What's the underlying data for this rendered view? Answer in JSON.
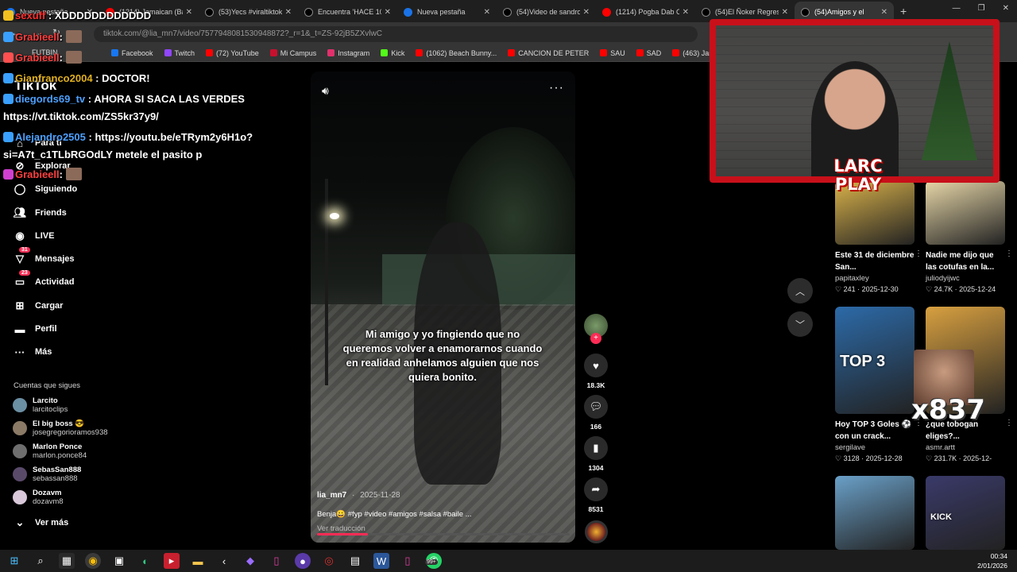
{
  "browser": {
    "tabs": [
      {
        "title": "Nueva pestaña",
        "color": "#1a73e8",
        "active": false
      },
      {
        "title": "(1214) Jamaican (Bam",
        "color": "#ff0000",
        "active": false
      },
      {
        "title": "(53)Yecs #viraltiktok #",
        "color": "#000000",
        "active": false
      },
      {
        "title": "Encuentra 'HACE 10 /",
        "color": "#000000",
        "active": false
      },
      {
        "title": "Nueva pestaña",
        "color": "#1a73e8",
        "active": false
      },
      {
        "title": "(54)Video de sandro",
        "color": "#000000",
        "active": false
      },
      {
        "title": "(1214) Pogba Dab Ce",
        "color": "#ff0000",
        "active": false
      },
      {
        "title": "(54)El Ñoker Regresa",
        "color": "#000000",
        "active": false
      },
      {
        "title": "(54)Amigos y el",
        "color": "#000000",
        "active": true
      }
    ],
    "url": "tiktok.com/@lia_mn7/video/7577948081530948872?_r=1&_t=ZS-92jB5ZXvlwC",
    "bookmarks": [
      {
        "label": "Facebook",
        "color": "#1877f2"
      },
      {
        "label": "Twitch",
        "color": "#9146ff"
      },
      {
        "label": "(72) YouTube",
        "color": "#ff0000"
      },
      {
        "label": "Mi Campus",
        "color": "#c8102e"
      },
      {
        "label": "Instagram",
        "color": "#e1306c"
      },
      {
        "label": "Kick",
        "color": "#53fc18"
      },
      {
        "label": "(1062) Beach Bunny...",
        "color": "#ff0000"
      },
      {
        "label": "CANCION DE PETER",
        "color": "#ff0000"
      },
      {
        "label": "SAU",
        "color": "#ff0000"
      },
      {
        "label": "SAD",
        "color": "#ff0000"
      },
      {
        "label": "(463) James Arthur -...",
        "color": "#ff0000"
      },
      {
        "label": "DR",
        "color": "#ff0000"
      }
    ],
    "bookmark_prefix": "FUTBIN"
  },
  "tiktok": {
    "logo": "TikTok",
    "nav": [
      {
        "label": "Para ti",
        "icon": "home-icon",
        "badge": ""
      },
      {
        "label": "Explorar",
        "icon": "compass-icon",
        "badge": ""
      },
      {
        "label": "Siguiendo",
        "icon": "following-icon",
        "badge": ""
      },
      {
        "label": "Friends",
        "icon": "friends-icon",
        "badge": ""
      },
      {
        "label": "LIVE",
        "icon": "live-icon",
        "badge": ""
      },
      {
        "label": "Mensajes",
        "icon": "messages-icon",
        "badge": "31"
      },
      {
        "label": "Actividad",
        "icon": "activity-icon",
        "badge": "23"
      },
      {
        "label": "Cargar",
        "icon": "upload-icon",
        "badge": ""
      },
      {
        "label": "Perfil",
        "icon": "profile-icon",
        "badge": ""
      },
      {
        "label": "Más",
        "icon": "more-icon",
        "badge": ""
      }
    ],
    "following_title": "Cuentas que sigues",
    "following": [
      {
        "name": "Larcito",
        "handle": "larcitoclips",
        "color": "#6b8fa3"
      },
      {
        "name": "El big boss 😎",
        "handle": "josegregorioramos938",
        "color": "#8a7a66"
      },
      {
        "name": "Marlon Ponce",
        "handle": "marlon.ponce84",
        "color": "#6e6e6e"
      },
      {
        "name": "SebasSan888",
        "handle": "sebassan888",
        "color": "#5a4a6a"
      },
      {
        "name": "Dozavm",
        "handle": "dozavm8",
        "color": "#d9c8d9"
      }
    ],
    "see_more": "Ver más",
    "video": {
      "caption": "Mi amigo y yo fingiendo que no queremos volver a enamorarnos cuando en realidad anhelamos alguien que nos quiera bonito.",
      "author": "lia_mn7",
      "date": "2025-11-28",
      "description": "Benja😀 #fyp #video #amigos #salsa #baile ...",
      "translate": "Ver traducción",
      "progress": 0.2
    },
    "actions": {
      "likes": "18.3K",
      "comments": "166",
      "saves": "1304",
      "shares": "8531"
    },
    "recommendations": [
      {
        "title": "Este 31 de diciembre San...",
        "user": "papitaxley",
        "likes": "241",
        "date": "2025-12-30",
        "thumb": "#d9b24a"
      },
      {
        "title": "Nadie me dijo que las cotufas en la...",
        "user": "juliodyijwc",
        "likes": "24.7K",
        "date": "2025-12-24",
        "thumb": "#e7d7a8"
      },
      {
        "title": "Hoy TOP 3 Goles ⚽ con un crack...",
        "user": "sergilave",
        "likes": "3128",
        "date": "2025-12-28",
        "thumb": "#2c6aa8",
        "thumb_text": "TOP 3"
      },
      {
        "title": "¿que tobogan eliges?...",
        "user": "asmr.artt",
        "likes": "231.7K",
        "date": "2025-12-",
        "thumb": "#d8a040"
      },
      {
        "title": "",
        "user": "",
        "likes": "",
        "date": "",
        "thumb": "#6aa0c8"
      },
      {
        "title": "",
        "user": "",
        "likes": "",
        "date": "",
        "thumb": "#3a3a6a",
        "thumb_text": "KICK"
      }
    ]
  },
  "chat": [
    {
      "user": "sexuff",
      "user_color": "#ff3030",
      "message": "XDDDDDDDDDDDD"
    },
    {
      "user": "Grabieell",
      "user_color": "#ff4040",
      "message": ""
    },
    {
      "user": "Grabieell",
      "user_color": "#ff4040",
      "message": ""
    },
    {
      "user": "Gianfranco2004",
      "user_color": "#e0b020",
      "message": "DOCTOR!"
    },
    {
      "user": "diegords69_tv",
      "user_color": "#4ea0ff",
      "message": "AHORA SI SACA LAS VERDES"
    },
    {
      "user": "",
      "user_color": "#ffffff",
      "message": "https://vt.tiktok.com/ZS5kr37y9/"
    },
    {
      "user": "Alejandro2505",
      "user_color": "#4ea0ff",
      "message": "https://youtu.be/eTRym2y6H1o?"
    },
    {
      "user": "",
      "user_color": "#ffffff",
      "message": "si=A7t_c1TLbRGOdLY metele el pasito p"
    },
    {
      "user": "Grabieell",
      "user_color": "#ff4040",
      "message": ""
    }
  ],
  "stream": {
    "logo_line1": "LARC",
    "logo_line2": "PLAY",
    "combo": "x837"
  },
  "taskbar": {
    "time": "00:34",
    "date": "2/01/2026",
    "badge": "99+"
  }
}
